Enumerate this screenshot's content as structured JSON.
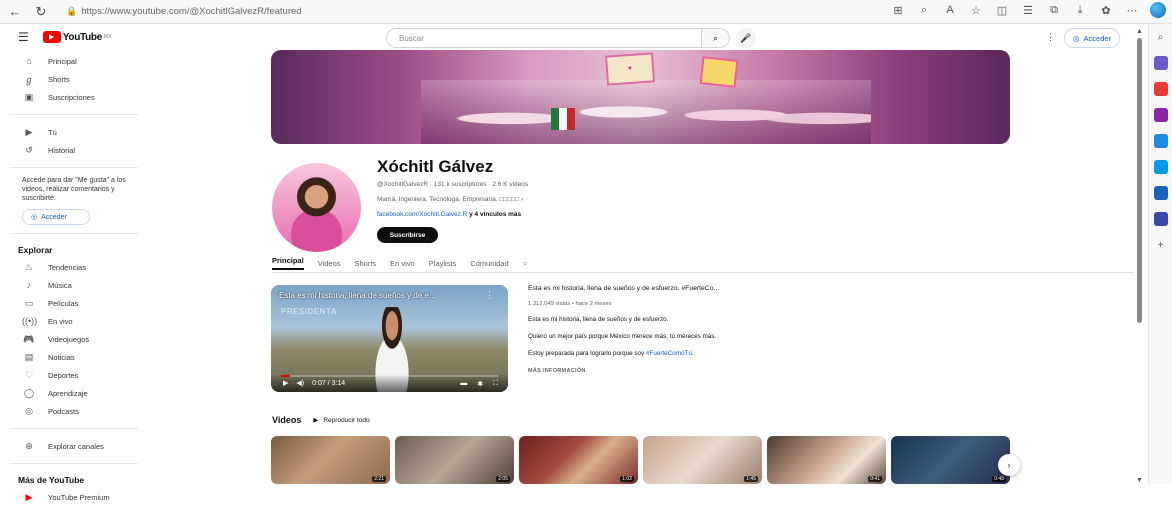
{
  "browser": {
    "url": "https://www.youtube.com/@XochitlGalvezR/featured"
  },
  "header": {
    "logo": "YouTube",
    "logo_region": "MX",
    "search_placeholder": "Buscar",
    "signin": "Acceder"
  },
  "sidebar": {
    "main": [
      {
        "icon": "home-icon",
        "label": "Principal"
      },
      {
        "icon": "shorts-icon",
        "label": "Shorts"
      },
      {
        "icon": "subscriptions-icon",
        "label": "Suscripciones"
      }
    ],
    "you": [
      {
        "icon": "you-icon",
        "label": "Tú"
      },
      {
        "icon": "history-icon",
        "label": "Historial"
      }
    ],
    "login_note": "Accede para dar \"Me gusta\" a los videos, realizar comentarios y suscribirte.",
    "signin": "Acceder",
    "explore_title": "Explorar",
    "explore": [
      {
        "icon": "trending-icon",
        "label": "Tendencias"
      },
      {
        "icon": "music-icon",
        "label": "Música"
      },
      {
        "icon": "movies-icon",
        "label": "Películas"
      },
      {
        "icon": "live-icon",
        "label": "En vivo"
      },
      {
        "icon": "gaming-icon",
        "label": "Videojuegos"
      },
      {
        "icon": "news-icon",
        "label": "Noticias"
      },
      {
        "icon": "sports-icon",
        "label": "Deportes"
      },
      {
        "icon": "learning-icon",
        "label": "Aprendizaje"
      },
      {
        "icon": "podcasts-icon",
        "label": "Podcasts"
      }
    ],
    "browse_channels": "Explorar canales",
    "more_title": "Más de YouTube",
    "premium": "YouTube Premium"
  },
  "channel": {
    "name": "Xóchitl Gálvez",
    "meta": "@XochitlGalvezR · 131 k suscriptores · 2.6 K videos",
    "description": "Mamá. Ingeniera. Tecnóloga. Empresaria. □□□□□",
    "link": "facebook.com/Xochitl.Galvez.R",
    "more_links": " y 4 vínculos más",
    "subscribe": "Suscribirse"
  },
  "tabs": [
    "Principal",
    "Videos",
    "Shorts",
    "En vivo",
    "Playlists",
    "Comunidad"
  ],
  "featured": {
    "overlay_title": "Esta es mi historia, llena de sueños y de e...",
    "watermark": "PRESIDENTA",
    "time": "0:07 / 3:14",
    "progress": 0.04,
    "title": "Esta es mi historia, llena de sueños y de esfuerzo. #FuerteCo...",
    "stats": "1,312,049 vistas • hace 2 meses",
    "p1": "Esta es mi historia, llena de sueños y de esfuerzo.",
    "p2": "Quiero un mejor país porque México merece más, tú mereces más.",
    "p3_text": "Estoy preparada para lograrlo porque soy ",
    "p3_tag": "#FuerteComoTú",
    "p3_end": ".",
    "more": "MÁS INFORMACIÓN"
  },
  "shelf": {
    "title": "Videos",
    "play_all": "Reproducir todo",
    "durations": [
      "2:21",
      "2:05",
      "1:02",
      "1:45",
      "0:41",
      "0:48"
    ]
  }
}
